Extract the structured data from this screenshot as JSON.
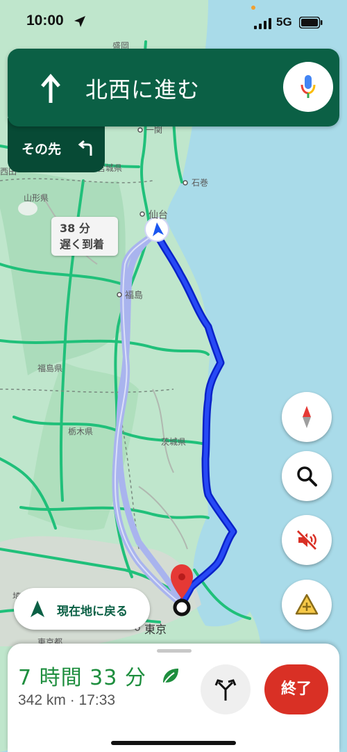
{
  "status_bar": {
    "time": "10:00",
    "network": "5G"
  },
  "navigation": {
    "instruction": "北西に進む",
    "then_label": "その先"
  },
  "map": {
    "place_labels": {
      "morioka_partial": "盛岡",
      "ichinoseki": "一関",
      "miyagi": "宮城県",
      "ishinomaki": "石巻",
      "yamagata": "山形県",
      "sendai": "仙台",
      "fukushima_city": "福島",
      "fukushima_pref": "福島県",
      "tochigi": "栃木県",
      "ibaraki": "茨城県",
      "tokyo": "東京",
      "tokyo_to": "東京都",
      "west_edge": "西田",
      "saitama_partial": "埼"
    },
    "alt_route_label": {
      "line1": "38 分",
      "line2": "遅く到着"
    },
    "colors": {
      "land": "#bfe6cc",
      "water": "#a9dbe9",
      "road": "#20c07a",
      "route_primary": "#1a35e8",
      "route_alt": "#a9b4ee"
    }
  },
  "controls": {
    "compass": "compass-icon",
    "search": "search-icon",
    "mute": "sound-off-icon",
    "report": "add-report-icon",
    "recenter_label": "現在地に戻る"
  },
  "trip": {
    "duration": "7 時間 33 分",
    "details": "342 km · 17:33",
    "exit_label": "終了"
  }
}
